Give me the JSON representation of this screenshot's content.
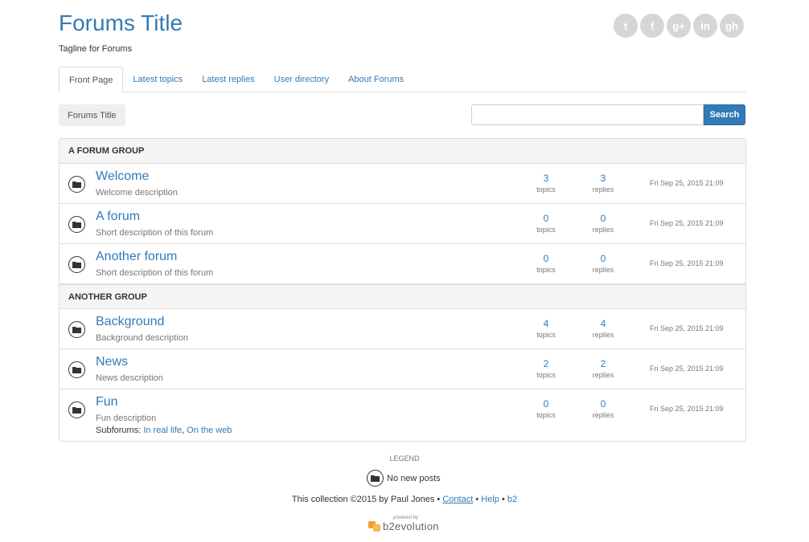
{
  "header": {
    "title": "Forums Title",
    "tagline": "Tagline for Forums",
    "social": [
      {
        "icon": "twitter-icon",
        "glyph": "t"
      },
      {
        "icon": "facebook-icon",
        "glyph": "f"
      },
      {
        "icon": "google-plus-icon",
        "glyph": "g+"
      },
      {
        "icon": "linkedin-icon",
        "glyph": "in"
      },
      {
        "icon": "github-icon",
        "glyph": "gh"
      }
    ]
  },
  "tabs": [
    "Front Page",
    "Latest topics",
    "Latest replies",
    "User directory",
    "About Forums"
  ],
  "breadcrumb": "Forums Title",
  "search": {
    "placeholder": "",
    "button": "Search"
  },
  "groups": [
    {
      "name": "A FORUM GROUP",
      "forums": [
        {
          "name": "Welcome",
          "desc": "Welcome description",
          "topics": "3",
          "replies": "3",
          "date": "Fri Sep 25, 2015 21:09"
        },
        {
          "name": "A forum",
          "desc": "Short description of this forum",
          "topics": "0",
          "replies": "0",
          "date": "Fri Sep 25, 2015 21:09"
        },
        {
          "name": "Another forum",
          "desc": "Short description of this forum",
          "topics": "0",
          "replies": "0",
          "date": "Fri Sep 25, 2015 21:09"
        }
      ]
    },
    {
      "name": "ANOTHER GROUP",
      "forums": [
        {
          "name": "Background",
          "desc": "Background description",
          "topics": "4",
          "replies": "4",
          "date": "Fri Sep 25, 2015 21:09"
        },
        {
          "name": "News",
          "desc": "News description",
          "topics": "2",
          "replies": "2",
          "date": "Fri Sep 25, 2015 21:09"
        },
        {
          "name": "Fun",
          "desc": "Fun description",
          "topics": "0",
          "replies": "0",
          "date": "Fri Sep 25, 2015 21:09",
          "subforums_label": "Subforums:",
          "subforums": [
            "In real life",
            "On the web"
          ]
        }
      ]
    }
  ],
  "labels": {
    "topics": "topics",
    "replies": "replies"
  },
  "legend": {
    "title": "LEGEND",
    "item": "No new posts"
  },
  "footer": {
    "prefix": "This collection ©2015 by Paul Jones",
    "sep": "•",
    "contact": "Contact",
    "help": "Help",
    "b2": "b2"
  },
  "powered": {
    "text": "powered by",
    "name": "b2evolution"
  },
  "colors": {
    "accent": "#337ab7",
    "muted": "#777777",
    "border": "#dddddd",
    "header_bg": "#f5f5f5"
  }
}
